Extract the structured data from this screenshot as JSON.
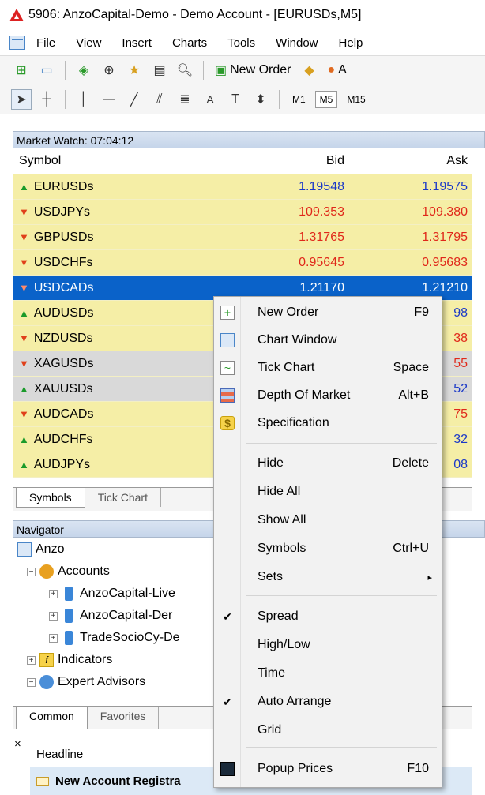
{
  "window": {
    "title": "5906: AnzoCapital-Demo - Demo Account - [EURUSDs,M5]"
  },
  "menu": [
    "File",
    "View",
    "Insert",
    "Charts",
    "Tools",
    "Window",
    "Help"
  ],
  "toolbar": {
    "new_order_label": "New Order",
    "auto_trading_label": "A"
  },
  "timeframes": {
    "m1": "M1",
    "m5": "M5",
    "m15": "M15"
  },
  "market_watch": {
    "title": "Market Watch: 07:04:12",
    "columns": {
      "symbol": "Symbol",
      "bid": "Bid",
      "ask": "Ask"
    },
    "rows": [
      {
        "symbol": "EURUSDs",
        "bid": "1.19548",
        "ask": "1.19575",
        "dir": "up",
        "bg": "yellow",
        "color": "blue"
      },
      {
        "symbol": "USDJPYs",
        "bid": "109.353",
        "ask": "109.380",
        "dir": "down",
        "bg": "yellow",
        "color": "red"
      },
      {
        "symbol": "GBPUSDs",
        "bid": "1.31765",
        "ask": "1.31795",
        "dir": "down",
        "bg": "yellow",
        "color": "red"
      },
      {
        "symbol": "USDCHFs",
        "bid": "0.95645",
        "ask": "0.95683",
        "dir": "down",
        "bg": "yellow",
        "color": "red"
      },
      {
        "symbol": "USDCADs",
        "bid": "1.21170",
        "ask": "1.21210",
        "dir": "down",
        "bg": "selected",
        "color": "white"
      },
      {
        "symbol": "AUDUSDs",
        "bid": "",
        "ask": "98",
        "dir": "up",
        "bg": "yellow",
        "color": "blue"
      },
      {
        "symbol": "NZDUSDs",
        "bid": "",
        "ask": "38",
        "dir": "down",
        "bg": "yellow",
        "color": "red"
      },
      {
        "symbol": "XAGUSDs",
        "bid": "",
        "ask": "55",
        "dir": "down",
        "bg": "gray",
        "color": "red"
      },
      {
        "symbol": "XAUUSDs",
        "bid": "",
        "ask": "52",
        "dir": "up",
        "bg": "gray",
        "color": "blue"
      },
      {
        "symbol": "AUDCADs",
        "bid": "",
        "ask": "75",
        "dir": "down",
        "bg": "yellow",
        "color": "red"
      },
      {
        "symbol": "AUDCHFs",
        "bid": "",
        "ask": "32",
        "dir": "up",
        "bg": "yellow",
        "color": "blue"
      },
      {
        "symbol": "AUDJPYs",
        "bid": "",
        "ask": "08",
        "dir": "up",
        "bg": "yellow",
        "color": "blue"
      }
    ],
    "tabs": [
      "Symbols",
      "Tick Chart"
    ]
  },
  "navigator": {
    "title": "Navigator",
    "root": "Anzo",
    "accounts_label": "Accounts",
    "accounts": [
      "AnzoCapital-Live",
      "AnzoCapital-Der",
      "TradeSocioCy-De"
    ],
    "indicators_label": "Indicators",
    "experts_label": "Expert Advisors",
    "tabs": [
      "Common",
      "Favorites"
    ]
  },
  "news": {
    "close": "×",
    "column": "Headline",
    "row": "New Account Registra"
  },
  "context_menu": {
    "items": [
      {
        "label": "New Order",
        "shortcut": "F9",
        "icon": "new-order-icon"
      },
      {
        "label": "Chart Window",
        "shortcut": "",
        "icon": "chart-window-icon"
      },
      {
        "label": "Tick Chart",
        "shortcut": "Space",
        "icon": "tick-chart-icon"
      },
      {
        "label": "Depth Of Market",
        "shortcut": "Alt+B",
        "icon": "depth-of-market-icon"
      },
      {
        "label": "Specification",
        "shortcut": "",
        "icon": "specification-icon"
      },
      {
        "label": "Hide",
        "shortcut": "Delete"
      },
      {
        "label": "Hide All",
        "shortcut": ""
      },
      {
        "label": "Show All",
        "shortcut": ""
      },
      {
        "label": "Symbols",
        "shortcut": "Ctrl+U"
      },
      {
        "label": "Sets",
        "shortcut": "▸"
      },
      {
        "label": "Spread",
        "shortcut": "",
        "checked": true
      },
      {
        "label": "High/Low",
        "shortcut": ""
      },
      {
        "label": "Time",
        "shortcut": ""
      },
      {
        "label": "Auto Arrange",
        "shortcut": "",
        "checked": true
      },
      {
        "label": "Grid",
        "shortcut": ""
      },
      {
        "label": "Popup Prices",
        "shortcut": "F10",
        "icon": "popup-prices-icon"
      }
    ]
  }
}
